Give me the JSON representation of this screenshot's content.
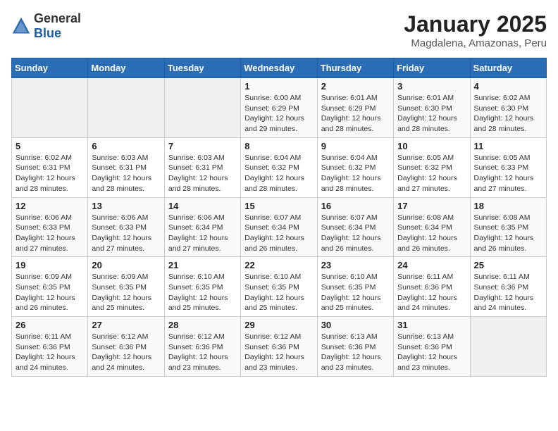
{
  "header": {
    "logo_general": "General",
    "logo_blue": "Blue",
    "month": "January 2025",
    "location": "Magdalena, Amazonas, Peru"
  },
  "weekdays": [
    "Sunday",
    "Monday",
    "Tuesday",
    "Wednesday",
    "Thursday",
    "Friday",
    "Saturday"
  ],
  "weeks": [
    [
      {
        "day": "",
        "info": ""
      },
      {
        "day": "",
        "info": ""
      },
      {
        "day": "",
        "info": ""
      },
      {
        "day": "1",
        "info": "Sunrise: 6:00 AM\nSunset: 6:29 PM\nDaylight: 12 hours\nand 29 minutes."
      },
      {
        "day": "2",
        "info": "Sunrise: 6:01 AM\nSunset: 6:29 PM\nDaylight: 12 hours\nand 28 minutes."
      },
      {
        "day": "3",
        "info": "Sunrise: 6:01 AM\nSunset: 6:30 PM\nDaylight: 12 hours\nand 28 minutes."
      },
      {
        "day": "4",
        "info": "Sunrise: 6:02 AM\nSunset: 6:30 PM\nDaylight: 12 hours\nand 28 minutes."
      }
    ],
    [
      {
        "day": "5",
        "info": "Sunrise: 6:02 AM\nSunset: 6:31 PM\nDaylight: 12 hours\nand 28 minutes."
      },
      {
        "day": "6",
        "info": "Sunrise: 6:03 AM\nSunset: 6:31 PM\nDaylight: 12 hours\nand 28 minutes."
      },
      {
        "day": "7",
        "info": "Sunrise: 6:03 AM\nSunset: 6:31 PM\nDaylight: 12 hours\nand 28 minutes."
      },
      {
        "day": "8",
        "info": "Sunrise: 6:04 AM\nSunset: 6:32 PM\nDaylight: 12 hours\nand 28 minutes."
      },
      {
        "day": "9",
        "info": "Sunrise: 6:04 AM\nSunset: 6:32 PM\nDaylight: 12 hours\nand 28 minutes."
      },
      {
        "day": "10",
        "info": "Sunrise: 6:05 AM\nSunset: 6:32 PM\nDaylight: 12 hours\nand 27 minutes."
      },
      {
        "day": "11",
        "info": "Sunrise: 6:05 AM\nSunset: 6:33 PM\nDaylight: 12 hours\nand 27 minutes."
      }
    ],
    [
      {
        "day": "12",
        "info": "Sunrise: 6:06 AM\nSunset: 6:33 PM\nDaylight: 12 hours\nand 27 minutes."
      },
      {
        "day": "13",
        "info": "Sunrise: 6:06 AM\nSunset: 6:33 PM\nDaylight: 12 hours\nand 27 minutes."
      },
      {
        "day": "14",
        "info": "Sunrise: 6:06 AM\nSunset: 6:34 PM\nDaylight: 12 hours\nand 27 minutes."
      },
      {
        "day": "15",
        "info": "Sunrise: 6:07 AM\nSunset: 6:34 PM\nDaylight: 12 hours\nand 26 minutes."
      },
      {
        "day": "16",
        "info": "Sunrise: 6:07 AM\nSunset: 6:34 PM\nDaylight: 12 hours\nand 26 minutes."
      },
      {
        "day": "17",
        "info": "Sunrise: 6:08 AM\nSunset: 6:34 PM\nDaylight: 12 hours\nand 26 minutes."
      },
      {
        "day": "18",
        "info": "Sunrise: 6:08 AM\nSunset: 6:35 PM\nDaylight: 12 hours\nand 26 minutes."
      }
    ],
    [
      {
        "day": "19",
        "info": "Sunrise: 6:09 AM\nSunset: 6:35 PM\nDaylight: 12 hours\nand 26 minutes."
      },
      {
        "day": "20",
        "info": "Sunrise: 6:09 AM\nSunset: 6:35 PM\nDaylight: 12 hours\nand 25 minutes."
      },
      {
        "day": "21",
        "info": "Sunrise: 6:10 AM\nSunset: 6:35 PM\nDaylight: 12 hours\nand 25 minutes."
      },
      {
        "day": "22",
        "info": "Sunrise: 6:10 AM\nSunset: 6:35 PM\nDaylight: 12 hours\nand 25 minutes."
      },
      {
        "day": "23",
        "info": "Sunrise: 6:10 AM\nSunset: 6:35 PM\nDaylight: 12 hours\nand 25 minutes."
      },
      {
        "day": "24",
        "info": "Sunrise: 6:11 AM\nSunset: 6:36 PM\nDaylight: 12 hours\nand 24 minutes."
      },
      {
        "day": "25",
        "info": "Sunrise: 6:11 AM\nSunset: 6:36 PM\nDaylight: 12 hours\nand 24 minutes."
      }
    ],
    [
      {
        "day": "26",
        "info": "Sunrise: 6:11 AM\nSunset: 6:36 PM\nDaylight: 12 hours\nand 24 minutes."
      },
      {
        "day": "27",
        "info": "Sunrise: 6:12 AM\nSunset: 6:36 PM\nDaylight: 12 hours\nand 24 minutes."
      },
      {
        "day": "28",
        "info": "Sunrise: 6:12 AM\nSunset: 6:36 PM\nDaylight: 12 hours\nand 23 minutes."
      },
      {
        "day": "29",
        "info": "Sunrise: 6:12 AM\nSunset: 6:36 PM\nDaylight: 12 hours\nand 23 minutes."
      },
      {
        "day": "30",
        "info": "Sunrise: 6:13 AM\nSunset: 6:36 PM\nDaylight: 12 hours\nand 23 minutes."
      },
      {
        "day": "31",
        "info": "Sunrise: 6:13 AM\nSunset: 6:36 PM\nDaylight: 12 hours\nand 23 minutes."
      },
      {
        "day": "",
        "info": ""
      }
    ]
  ]
}
